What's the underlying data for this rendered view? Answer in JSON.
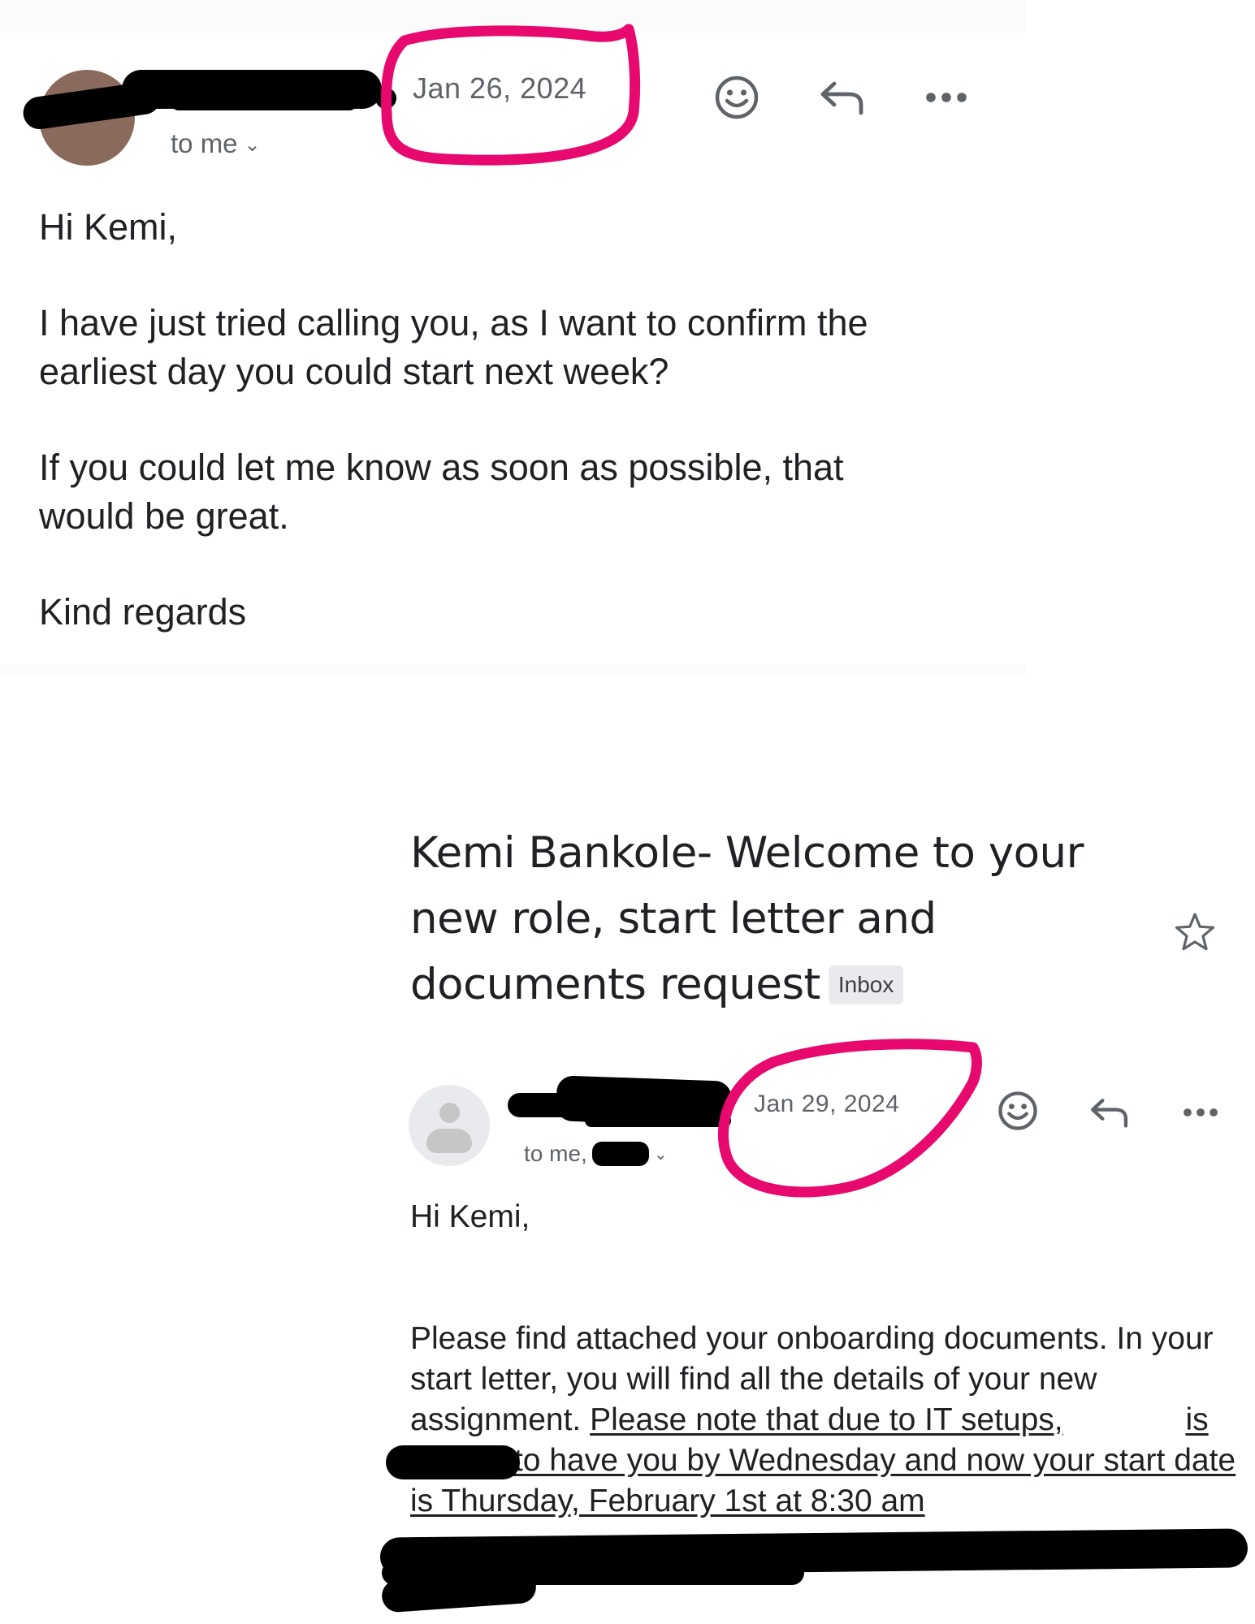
{
  "colors": {
    "annotation": "#e8096f",
    "muted": "#5f6368",
    "text": "#202124",
    "redaction": "#000000"
  },
  "email1": {
    "date": "Jan 26, 2024",
    "recipient_line": "to me",
    "actions": {
      "emoji_icon": "smile-icon",
      "reply_icon": "reply-icon",
      "more_icon": "more-horizontal-icon"
    },
    "body": {
      "greeting": "Hi Kemi,",
      "paragraph1": "I have just tried calling you, as I want to confirm the earliest day you could start next week?",
      "paragraph2": "If you could let me know as soon as possible, that would be great.",
      "closing": "Kind regards"
    }
  },
  "email2": {
    "subject": "Kemi Bankole- Welcome to your new role, start letter and documents request",
    "label": "Inbox",
    "star_icon": "star-outline-icon",
    "date": "Jan 29, 2024",
    "recipient_line": "to me,",
    "actions": {
      "emoji_icon": "smile-icon",
      "reply_icon": "reply-icon",
      "more_icon": "more-horizontal-icon"
    },
    "body": {
      "greeting": "Hi Kemi,",
      "paragraph_plain": "Please find attached your onboarding documents. In your start letter, you will find all the details of your new assignment.",
      "paragraph_underlined_part1": "Please note that due to IT setups,",
      "paragraph_underlined_part2": "is unable to have you by Wednesday and now your start date is Thursday, February 1st at 8:30 am"
    }
  }
}
